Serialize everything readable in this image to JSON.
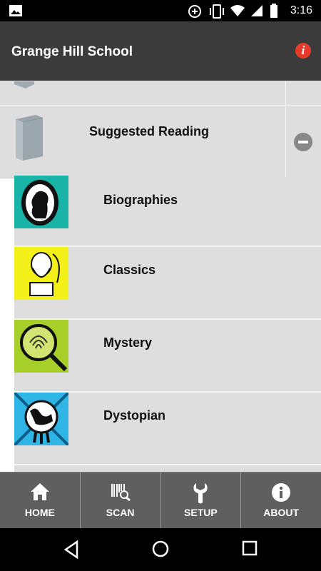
{
  "status_bar": {
    "time": "3:16",
    "icons": [
      "image-icon",
      "add-circle-icon",
      "vibrate-icon",
      "wifi-icon",
      "signal-icon",
      "battery-icon"
    ]
  },
  "app_bar": {
    "title": "Grange Hill School",
    "info_glyph": "i",
    "colors": {
      "background": "#3b3b3b",
      "info": "#e63a2a"
    }
  },
  "section": {
    "label": "Suggested Reading",
    "icon": "book-icon",
    "action_icon": "collapse-icon"
  },
  "categories": [
    {
      "label": "Biographies",
      "icon": "cameo-silhouette-icon",
      "color": "#19b3a8"
    },
    {
      "label": "Classics",
      "icon": "bust-statue-icon",
      "color": "#f4f01a"
    },
    {
      "label": "Mystery",
      "icon": "magnifier-fingerprint-icon",
      "color": "#a6cf2a"
    },
    {
      "label": "Dystopian",
      "icon": "broken-globe-icon",
      "color": "#2fb4e6"
    }
  ],
  "bottom_nav": [
    {
      "label": "HOME",
      "icon": "home-icon"
    },
    {
      "label": "SCAN",
      "icon": "barcode-scan-icon"
    },
    {
      "label": "SETUP",
      "icon": "wrench-icon"
    },
    {
      "label": "ABOUT",
      "icon": "info-icon"
    }
  ],
  "system_nav": [
    "back-icon",
    "home-circle-icon",
    "recents-icon"
  ]
}
